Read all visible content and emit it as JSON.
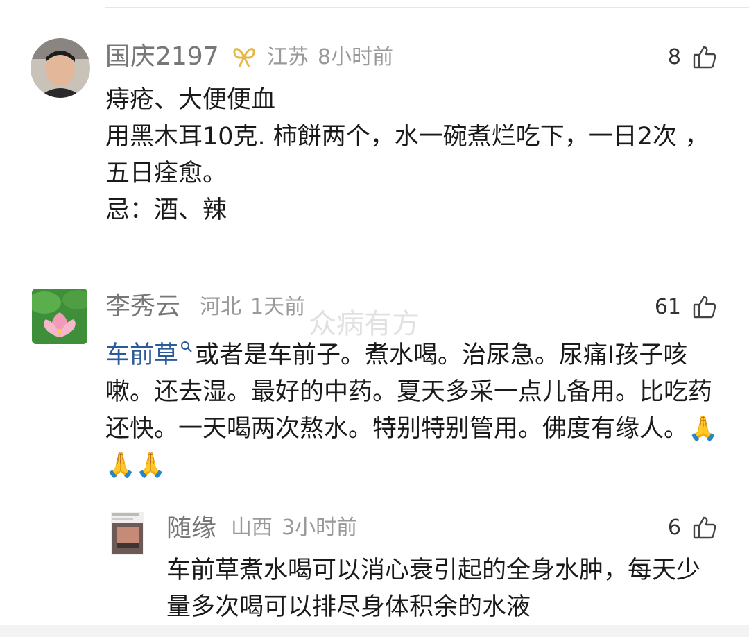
{
  "comments": [
    {
      "user": "国庆2197",
      "badge": "ribbon-icon",
      "location": "江苏",
      "time": "8小时前",
      "likes": "8",
      "lines": [
        "痔疮、大便便血",
        "用黑木耳10克. 柿餅两个，水一碗煮烂吃下，一日2次 ，五日痊愈。",
        "忌：酒、辣"
      ]
    },
    {
      "user": "李秀云",
      "location": "河北",
      "time": "1天前",
      "likes": "61",
      "link_text": "车前草",
      "text": "或者是车前子。煮水喝。治尿急。尿痛I孩子咳嗽。还去湿。最好的中药。夏天多采一点儿备用。比吃药还快。一天喝两次熬水。特别特别管用。佛度有缘人。🙏🙏🙏"
    }
  ],
  "reply": {
    "user": "随缘",
    "location": "山西",
    "time": "3小时前",
    "likes": "6",
    "text": "车前草煮水喝可以消心衰引起的全身水肿，每天少量多次喝可以排尽身体积余的水液"
  },
  "watermark": "众病有方",
  "colors": {
    "name": "#777777",
    "meta": "#999999",
    "link": "#2b5a9b",
    "divider": "#e6e6e6"
  }
}
